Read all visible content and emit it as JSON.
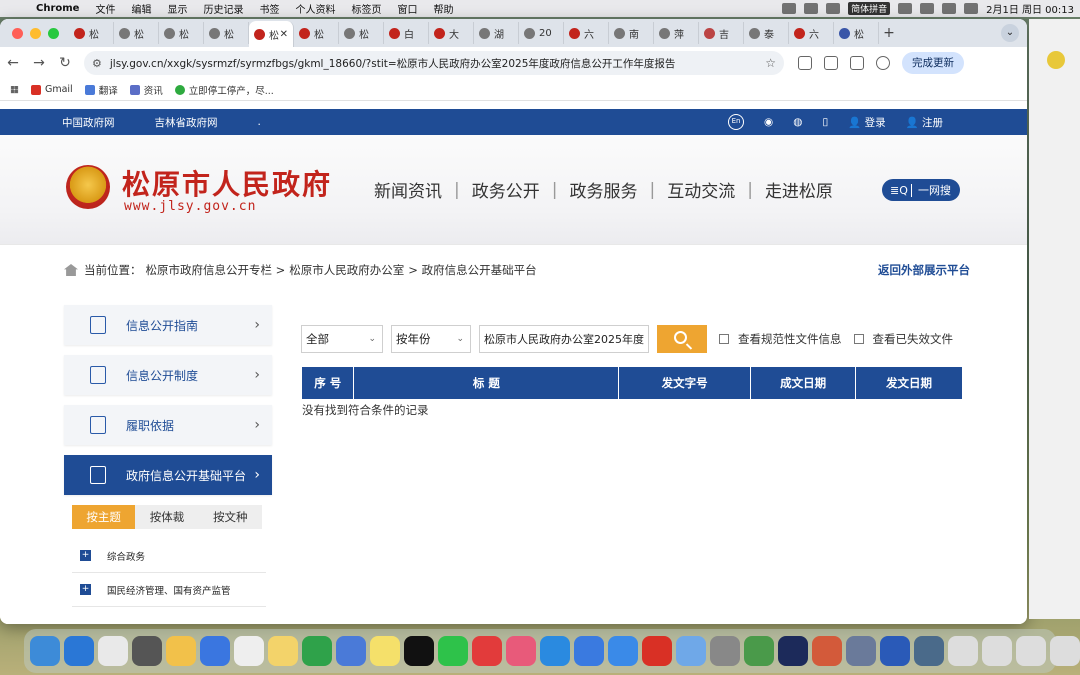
{
  "menubar": {
    "app": "Chrome",
    "items": [
      "文件",
      "编辑",
      "显示",
      "历史记录",
      "书签",
      "个人资料",
      "标签页",
      "窗口",
      "帮助"
    ],
    "ime": "简体拼音",
    "clock": "2月1日 周日  00:13"
  },
  "browser": {
    "tabs": [
      "松",
      "松",
      "松",
      "松",
      "松",
      "松",
      "松",
      "白",
      "大",
      "湖",
      "20",
      "六",
      "南",
      "萍",
      "吉",
      "泰",
      "六",
      "松"
    ],
    "active_tab_index": 4,
    "url": "jlsy.gov.cn/xxgk/sysrmzf/syrmzfbgs/gkml_18660/?stit=松原市人民政府办公室2025年度政府信息公开工作年度报告",
    "update_button": "完成更新",
    "bookmarks": [
      "Gmail",
      "翻译",
      "资讯",
      "立即停工停产，尽..."
    ]
  },
  "site": {
    "top_links": [
      "中国政府网",
      "吉林省政府网",
      "."
    ],
    "top_right": [
      "En",
      "登录",
      "注册"
    ],
    "title": "松原市人民政府",
    "url": "www.jlsy.gov.cn",
    "nav": [
      "新闻资讯",
      "政务公开",
      "政务服务",
      "互动交流",
      "走进松原"
    ],
    "search_label": "一网搜",
    "breadcrumb": {
      "prefix": "当前位置：",
      "items": [
        "松原市政府信息公开专栏 >",
        "松原市人民政府办公室",
        " > 政府信息公开基础平台"
      ],
      "back": "返回外部展示平台"
    },
    "side_menu": [
      {
        "label": "信息公开指南",
        "active": false
      },
      {
        "label": "信息公开制度",
        "active": false
      },
      {
        "label": "履职依据",
        "active": false
      },
      {
        "label": "政府信息公开基础平台",
        "active": true
      }
    ],
    "sub_tabs": [
      "按主题",
      "按体裁",
      "按文种"
    ],
    "categories": [
      "综合政务",
      "国民经济管理、国有资产监管"
    ],
    "filters": {
      "scope": "全部",
      "year": "按年份",
      "keyword": "松原市人民政府办公室2025年度",
      "check1": "查看规范性文件信息",
      "check2": "查看已失效文件"
    },
    "table": {
      "headers": [
        "序 号",
        "标 题",
        "发文字号",
        "成文日期",
        "发文日期"
      ],
      "empty": "没有找到符合条件的记录"
    }
  },
  "colors": {
    "brand_blue": "#1f4c95",
    "brand_red": "#c2241c",
    "accent_orange": "#eea531"
  }
}
